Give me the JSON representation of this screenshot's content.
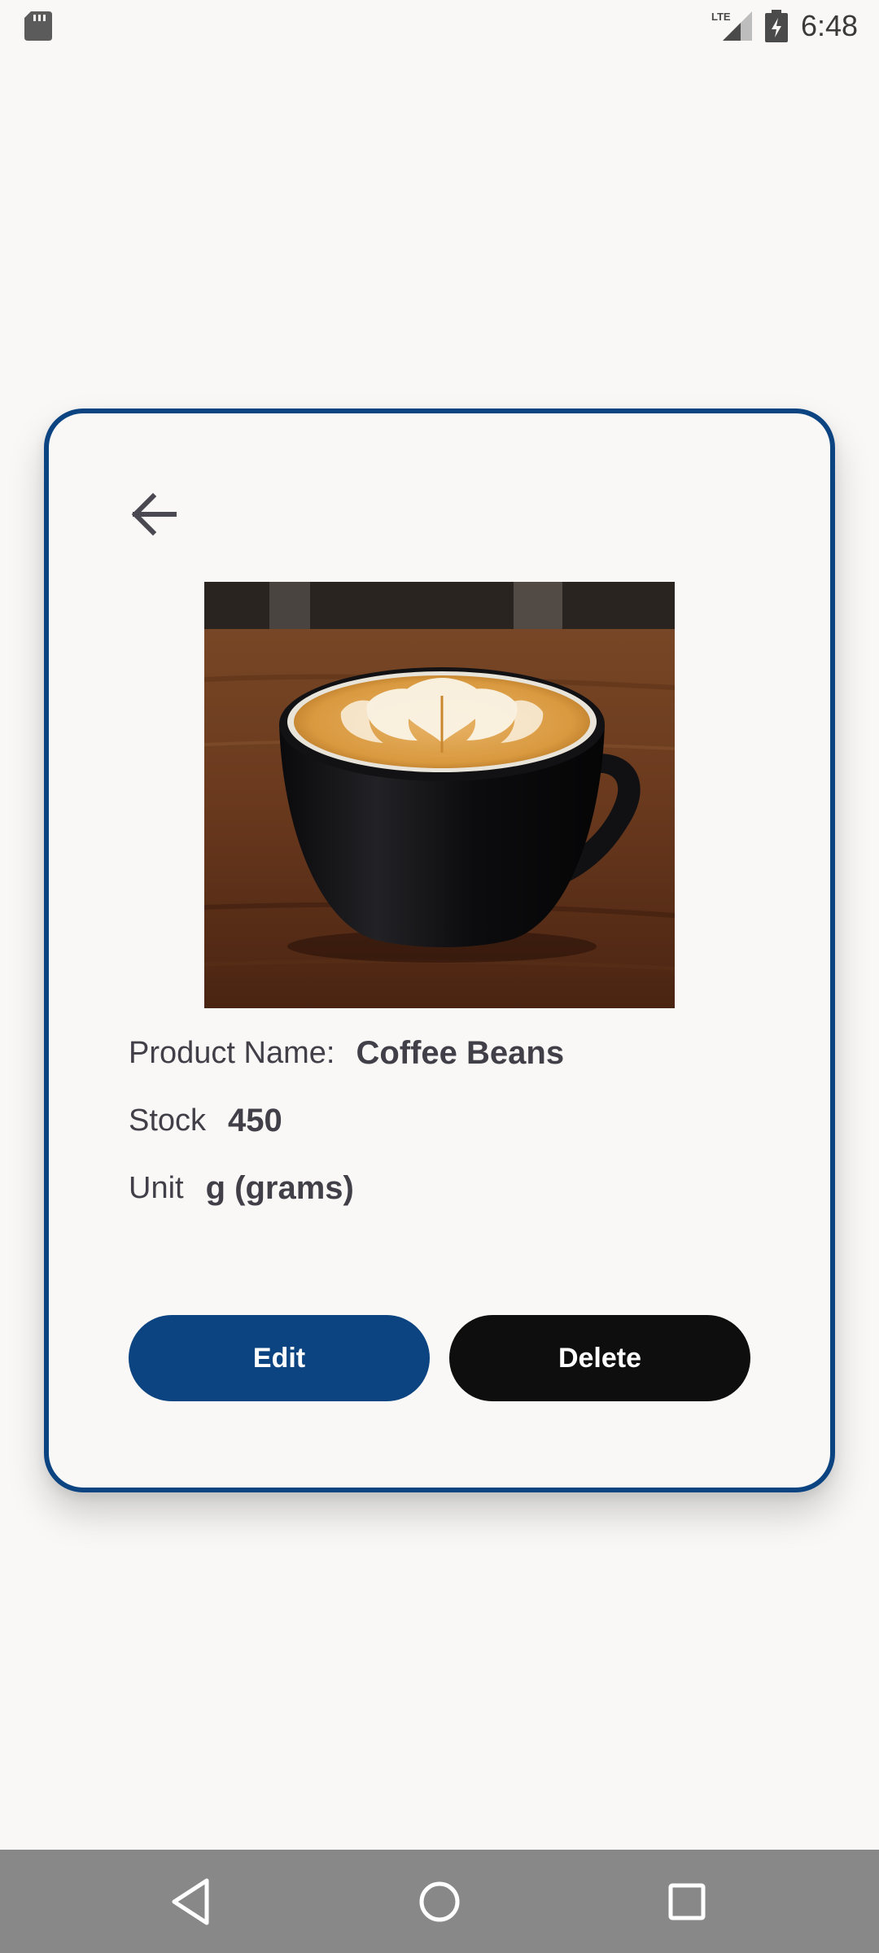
{
  "status_bar": {
    "time": "6:48",
    "network_label": "LTE",
    "icons": [
      "sd-card-icon",
      "lte-signal-icon",
      "battery-charging-icon"
    ]
  },
  "detail_card": {
    "back_icon": "arrow-left-icon",
    "image_description": "product-photo",
    "product_name_label": "Product Name:",
    "product_name_value": "Coffee Beans",
    "stock_label": "Stock",
    "stock_value": "450",
    "unit_label": "Unit",
    "unit_value": "g (grams)",
    "edit_label": "Edit",
    "delete_label": "Delete"
  },
  "nav_bar": {
    "icons": [
      "nav-back-icon",
      "nav-home-icon",
      "nav-recents-icon"
    ]
  },
  "colors": {
    "accent": "#0b4481",
    "delete_button": "#0e0e0e",
    "background": "#f9f8f6",
    "text": "#413f47",
    "nav_bar": "#888888"
  }
}
